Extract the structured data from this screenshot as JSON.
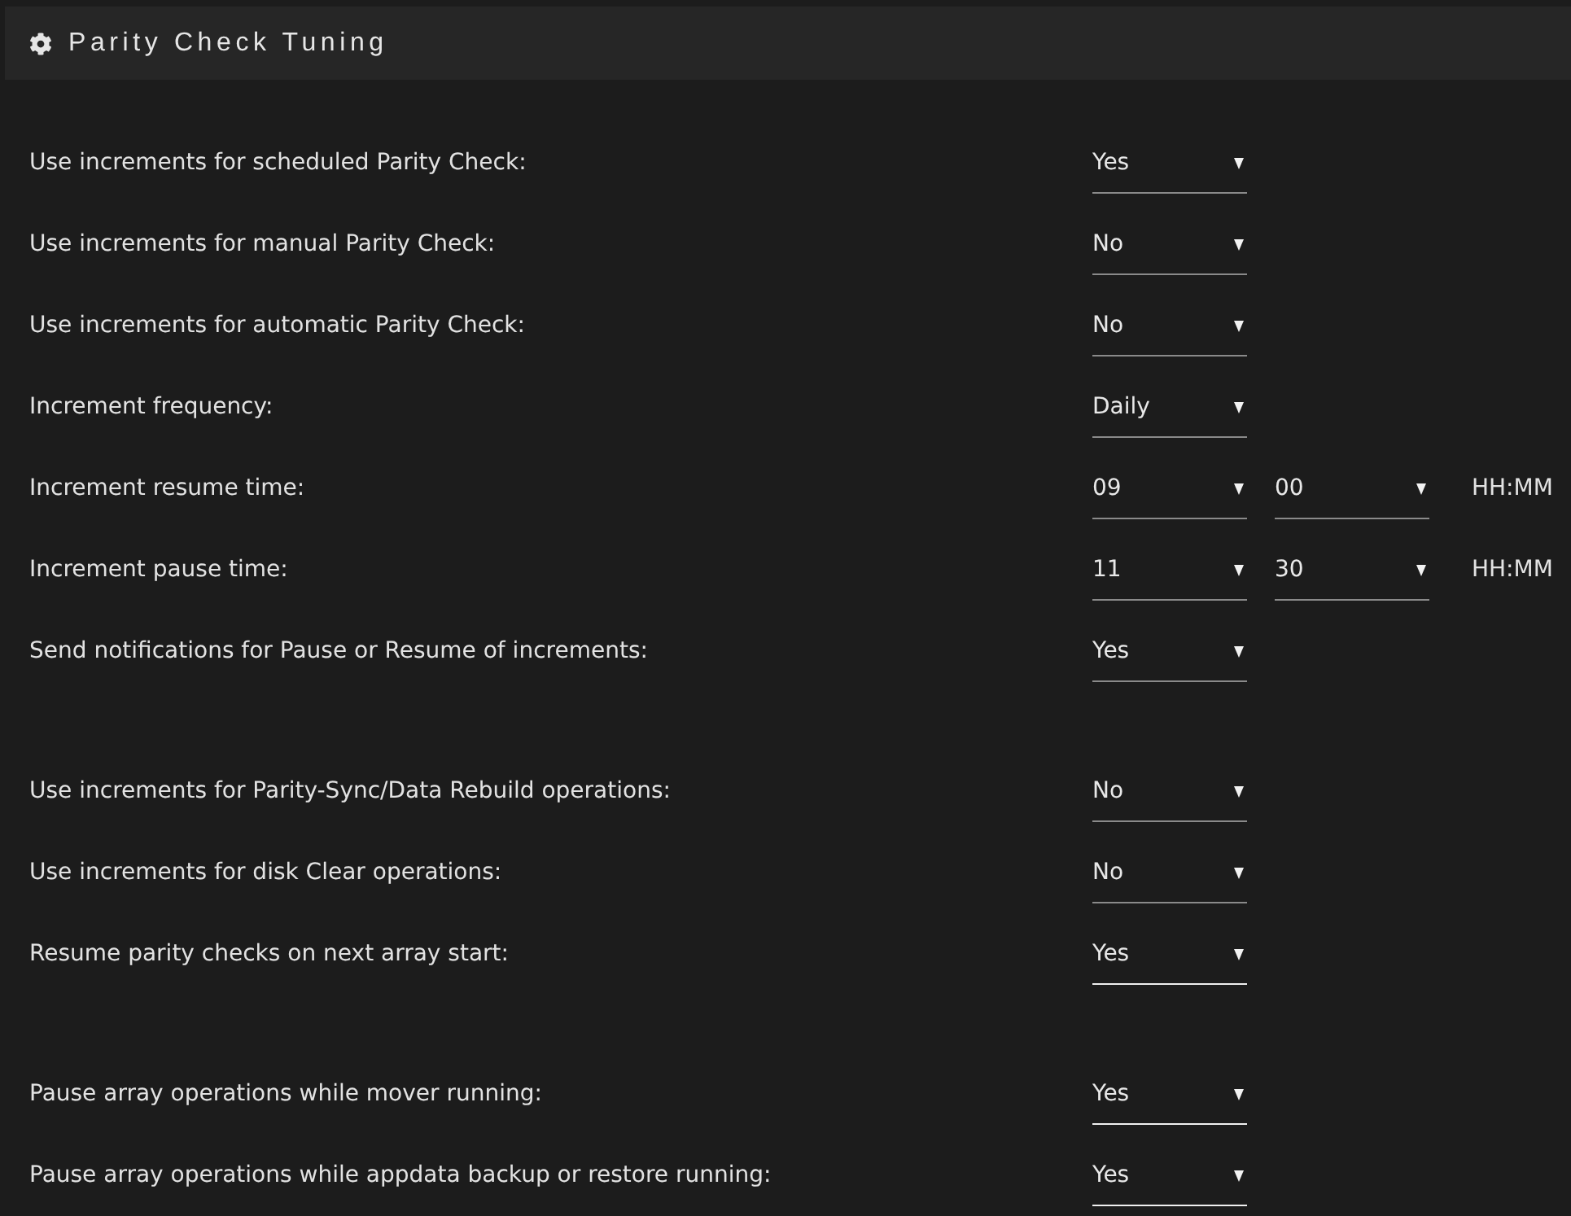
{
  "panel": {
    "title": "Parity Check Tuning"
  },
  "groups": [
    {
      "settings": [
        {
          "label": "Use increments for scheduled Parity Check:",
          "selects": [
            {
              "value": "Yes",
              "disabled": true
            }
          ]
        },
        {
          "label": "Use increments for manual Parity Check:",
          "selects": [
            {
              "value": "No",
              "disabled": true
            }
          ]
        },
        {
          "label": "Use increments for automatic Parity Check:",
          "selects": [
            {
              "value": "No",
              "disabled": true
            }
          ]
        },
        {
          "label": "Increment frequency:",
          "selects": [
            {
              "value": "Daily",
              "disabled": true
            }
          ]
        },
        {
          "label": "Increment resume time:",
          "selects": [
            {
              "value": "09",
              "disabled": true
            },
            {
              "value": "00",
              "disabled": true
            }
          ],
          "suffix": "HH:MM"
        },
        {
          "label": "Increment pause time:",
          "selects": [
            {
              "value": "11",
              "disabled": true
            },
            {
              "value": "30",
              "disabled": true
            }
          ],
          "suffix": "HH:MM"
        },
        {
          "label": "Send notifications for Pause or Resume of increments:",
          "selects": [
            {
              "value": "Yes",
              "disabled": true
            }
          ]
        }
      ]
    },
    {
      "settings": [
        {
          "label": "Use increments for Parity-Sync/Data Rebuild operations:",
          "selects": [
            {
              "value": "No",
              "disabled": true
            }
          ]
        },
        {
          "label": "Use increments for disk Clear operations:",
          "selects": [
            {
              "value": "No",
              "disabled": true
            }
          ]
        },
        {
          "label": "Resume parity checks on next array start:",
          "selects": [
            {
              "value": "Yes",
              "disabled": false
            }
          ]
        }
      ]
    },
    {
      "settings": [
        {
          "label": "Pause array operations while mover running:",
          "selects": [
            {
              "value": "Yes",
              "disabled": false
            }
          ]
        },
        {
          "label": "Pause array operations while appdata backup or restore running:",
          "selects": [
            {
              "value": "Yes",
              "disabled": false
            }
          ]
        }
      ]
    }
  ]
}
